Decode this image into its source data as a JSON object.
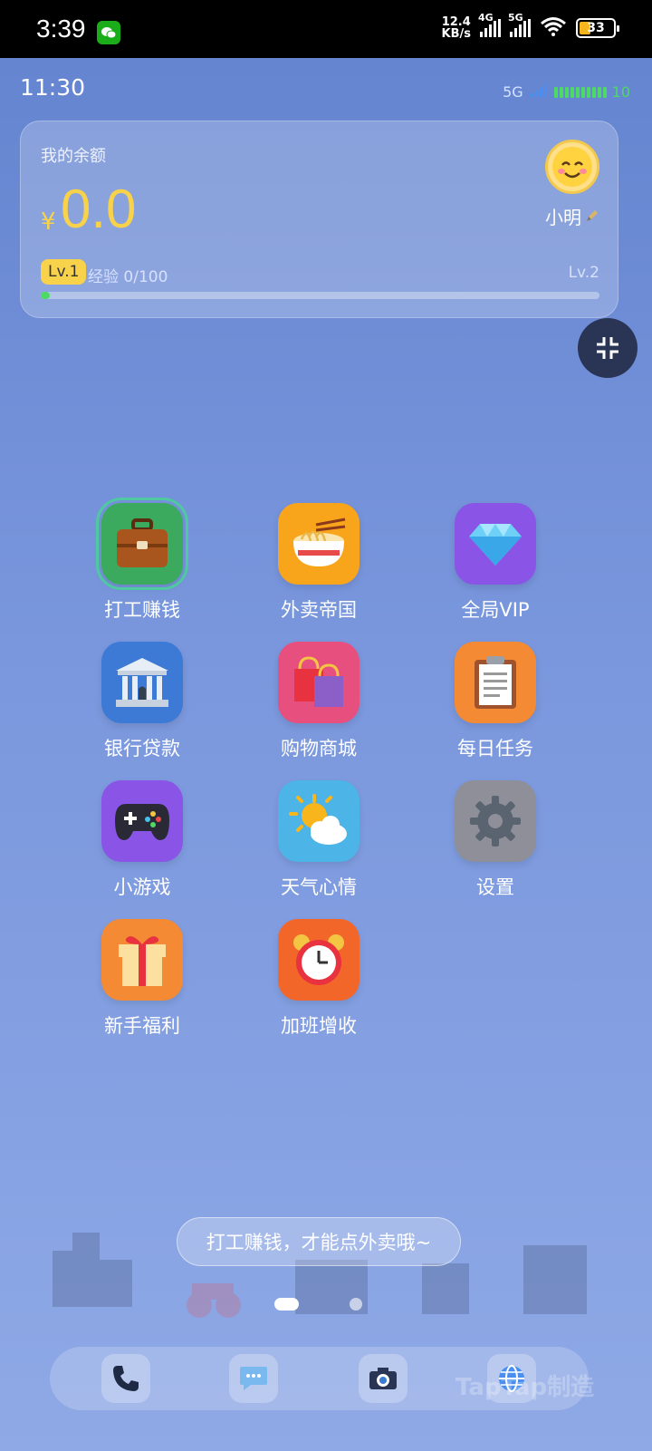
{
  "status_bar": {
    "time": "3:39",
    "net_speed_value": "12.4",
    "net_speed_unit": "KB/s",
    "signal1_label": "4G",
    "signal2_label": "5G",
    "battery": "33"
  },
  "app_status": {
    "time": "11:30",
    "network": "5G",
    "battery_value": "10"
  },
  "balance_card": {
    "label": "我的余额",
    "currency": "¥",
    "amount": "0.0",
    "username": "小明",
    "level_badge": "Lv.1",
    "experience": "经验 0/100",
    "next_level": "Lv.2",
    "exp_progress": 0.0
  },
  "apps": [
    {
      "label": "打工赚钱",
      "icon": "briefcase-icon",
      "color": "#3caa5e"
    },
    {
      "label": "外卖帝国",
      "icon": "noodle-bowl-icon",
      "color": "#f9a51c"
    },
    {
      "label": "全局VIP",
      "icon": "diamond-icon",
      "color": "#8a55e6"
    },
    {
      "label": "银行贷款",
      "icon": "bank-icon",
      "color": "#3c7ad6"
    },
    {
      "label": "购物商城",
      "icon": "shopping-bags-icon",
      "color": "#e74f7f"
    },
    {
      "label": "每日任务",
      "icon": "clipboard-icon",
      "color": "#f48a33"
    },
    {
      "label": "小游戏",
      "icon": "gamepad-icon",
      "color": "#8a55e6"
    },
    {
      "label": "天气心情",
      "icon": "sun-cloud-icon",
      "color": "#4cb4e6"
    },
    {
      "label": "设置",
      "icon": "gear-icon",
      "color": "#8e8f99"
    },
    {
      "label": "新手福利",
      "icon": "gift-icon",
      "color": "#f48a33"
    },
    {
      "label": "加班增收",
      "icon": "alarm-clock-icon",
      "color": "#f2662a"
    }
  ],
  "toast": "打工赚钱，才能点外卖哦~",
  "watermark": "TapTap制造",
  "dock": [
    "phone-icon",
    "message-icon",
    "camera-icon",
    "globe-icon"
  ]
}
